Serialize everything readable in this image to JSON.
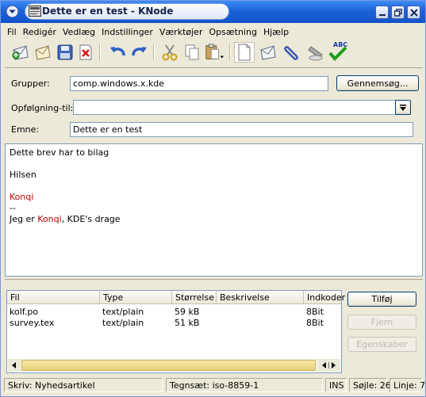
{
  "window": {
    "title": "Dette er en test - KNode"
  },
  "menubar": {
    "items": [
      "Fil",
      "Redigér",
      "Vedlæg",
      "Indstillinger",
      "Værktøjer",
      "Opsætning",
      "Hjælp"
    ]
  },
  "toolbar": {
    "icons": [
      "send-now-icon",
      "send-later-icon",
      "save-icon",
      "delete-icon",
      "undo-icon",
      "redo-icon",
      "cut-icon",
      "copy-icon",
      "paste-icon",
      "new-document-icon",
      "attach-file-icon",
      "attach-clip-icon",
      "sign-icon",
      "spellcheck-icon"
    ],
    "spell_label": "ABC"
  },
  "form": {
    "groups_label": "Grupper:",
    "groups_value": "comp.windows.x.kde",
    "browse_button": "Gennemsøg...",
    "followup_label": "Opfølgning-til:",
    "followup_value": "",
    "subject_label": "Emne:",
    "subject_value": "Dette er en test"
  },
  "body": {
    "line1": "Dette brev har to bilag",
    "line2": "Hilsen",
    "line3": "Konqi",
    "line4": "--",
    "line5_prefix": "Jeg er ",
    "line5_name": "Konqi",
    "line5_suffix": ", KDE's drage"
  },
  "attachments": {
    "columns": [
      "Fil",
      "Type",
      "Størrelse",
      "Beskrivelse",
      "Indkoder"
    ],
    "rows": [
      {
        "file": "kolf.po",
        "type": "text/plain",
        "size": "59 kB",
        "description": "",
        "encoder": "8Bit"
      },
      {
        "file": "survey.tex",
        "type": "text/plain",
        "size": "51 kB",
        "description": "",
        "encoder": "8Bit"
      }
    ],
    "add_button": "Tilføj",
    "remove_button": "Fjern",
    "properties_button": "Egenskaber"
  },
  "statusbar": {
    "type": "Skriv: Nyhedsartikel",
    "charset": "Tegnsæt: iso-8859-1",
    "mode": "INS",
    "column": "Søjle: 26",
    "line": "Linje: 7"
  },
  "colors": {
    "titlebar": "#1c62d8",
    "highlight_text": "#c00000",
    "scroll_thumb": "#e5d27a"
  }
}
